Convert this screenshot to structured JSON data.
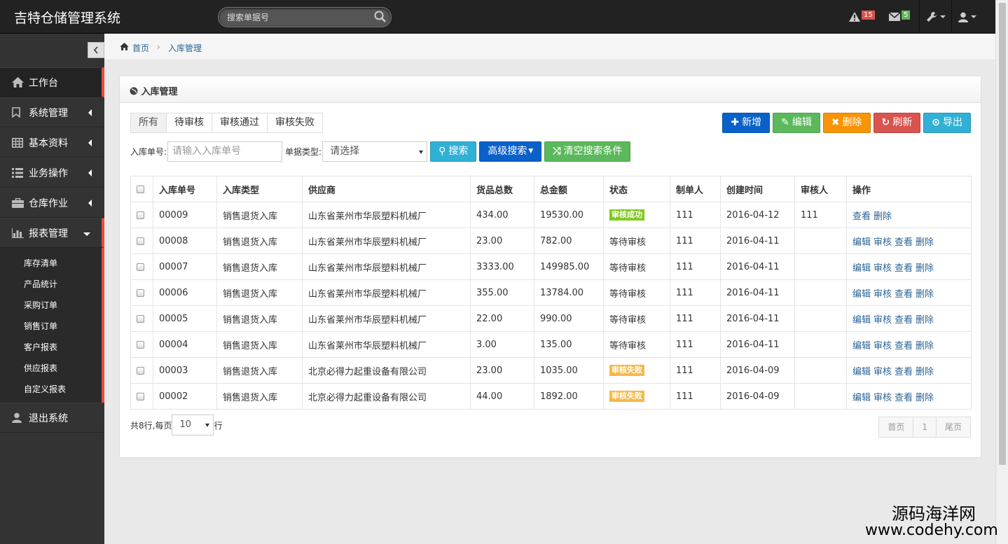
{
  "app": {
    "title": "吉特仓储管理系统"
  },
  "topbar": {
    "search_placeholder": "搜索单据号",
    "alerts_count": "15",
    "messages_count": "5"
  },
  "sidebar": {
    "items": [
      {
        "label": "工作台"
      },
      {
        "label": "系统管理"
      },
      {
        "label": "基本资料"
      },
      {
        "label": "业务操作"
      },
      {
        "label": "仓库作业"
      },
      {
        "label": "报表管理"
      },
      {
        "label": "退出系统"
      }
    ],
    "submenu": [
      "库存清单",
      "产品统计",
      "采购订单",
      "销售订单",
      "客户报表",
      "供应报表",
      "自定义报表"
    ]
  },
  "breadcrumb": {
    "home": "首页",
    "sep": "›",
    "current": "入库管理"
  },
  "panel": {
    "title": "入库管理"
  },
  "tabs": [
    "所有",
    "待审核",
    "审核通过",
    "审核失败"
  ],
  "buttons": {
    "add": "新增",
    "edit": "编辑",
    "delete": "删除",
    "refresh": "刷新",
    "export": "导出"
  },
  "filter": {
    "order_label": "入库单号:",
    "order_placeholder": "请输入入库单号",
    "type_label": "单据类型:",
    "type_value": "请选择",
    "search": "搜索",
    "advanced": "高级搜索",
    "clear": "清空搜索条件"
  },
  "table": {
    "headers": [
      "入库单号",
      "入库类型",
      "供应商",
      "货品总数",
      "总金额",
      "状态",
      "制单人",
      "创建时间",
      "审核人",
      "操作"
    ],
    "rows": [
      {
        "no": "00009",
        "type": "销售退货入库",
        "supplier": "山东省莱州市华辰塑料机械厂",
        "qty": "434.00",
        "amount": "19530.00",
        "status": "审核成功",
        "status_kind": "success",
        "creator": "111",
        "created": "2016-04-12",
        "auditor": "111",
        "ops": [
          "查看",
          "删除"
        ]
      },
      {
        "no": "00008",
        "type": "销售退货入库",
        "supplier": "山东省莱州市华辰塑料机械厂",
        "qty": "23.00",
        "amount": "782.00",
        "status": "等待审核",
        "status_kind": "text",
        "creator": "111",
        "created": "2016-04-11",
        "auditor": "",
        "ops": [
          "编辑",
          "审核",
          "查看",
          "删除"
        ]
      },
      {
        "no": "00007",
        "type": "销售退货入库",
        "supplier": "山东省莱州市华辰塑料机械厂",
        "qty": "3333.00",
        "amount": "149985.00",
        "status": "等待审核",
        "status_kind": "text",
        "creator": "111",
        "created": "2016-04-11",
        "auditor": "",
        "ops": [
          "编辑",
          "审核",
          "查看",
          "删除"
        ]
      },
      {
        "no": "00006",
        "type": "销售退货入库",
        "supplier": "山东省莱州市华辰塑料机械厂",
        "qty": "355.00",
        "amount": "13784.00",
        "status": "等待审核",
        "status_kind": "text",
        "creator": "111",
        "created": "2016-04-11",
        "auditor": "",
        "ops": [
          "编辑",
          "审核",
          "查看",
          "删除"
        ]
      },
      {
        "no": "00005",
        "type": "销售退货入库",
        "supplier": "山东省莱州市华辰塑料机械厂",
        "qty": "22.00",
        "amount": "990.00",
        "status": "等待审核",
        "status_kind": "text",
        "creator": "111",
        "created": "2016-04-11",
        "auditor": "",
        "ops": [
          "编辑",
          "审核",
          "查看",
          "删除"
        ]
      },
      {
        "no": "00004",
        "type": "销售退货入库",
        "supplier": "山东省莱州市华辰塑料机械厂",
        "qty": "3.00",
        "amount": "135.00",
        "status": "等待审核",
        "status_kind": "text",
        "creator": "111",
        "created": "2016-04-11",
        "auditor": "",
        "ops": [
          "编辑",
          "审核",
          "查看",
          "删除"
        ]
      },
      {
        "no": "00003",
        "type": "销售退货入库",
        "supplier": "北京必得力起重设备有限公司",
        "qty": "23.00",
        "amount": "1035.00",
        "status": "审核失败",
        "status_kind": "fail",
        "creator": "111",
        "created": "2016-04-09",
        "auditor": "",
        "ops": [
          "编辑",
          "审核",
          "查看",
          "删除"
        ]
      },
      {
        "no": "00002",
        "type": "销售退货入库",
        "supplier": "北京必得力起重设备有限公司",
        "qty": "44.00",
        "amount": "1892.00",
        "status": "审核失败",
        "status_kind": "fail",
        "creator": "111",
        "created": "2016-04-09",
        "auditor": "",
        "ops": [
          "编辑",
          "审核",
          "查看",
          "删除"
        ]
      }
    ]
  },
  "footer": {
    "total_prefix": "共8行,每页",
    "page_size": "10",
    "suffix": "行",
    "first": "首页",
    "page": "1",
    "last": "尾页"
  },
  "watermark": {
    "line1": "源码海洋网",
    "line2": "www.codehy.com"
  },
  "colors": {
    "primary": "#0a61c9",
    "success": "#5cb85c",
    "warning": "#f89406",
    "danger": "#d9534f",
    "info": "#31b0d5",
    "active_bar": "#e74c3c"
  }
}
